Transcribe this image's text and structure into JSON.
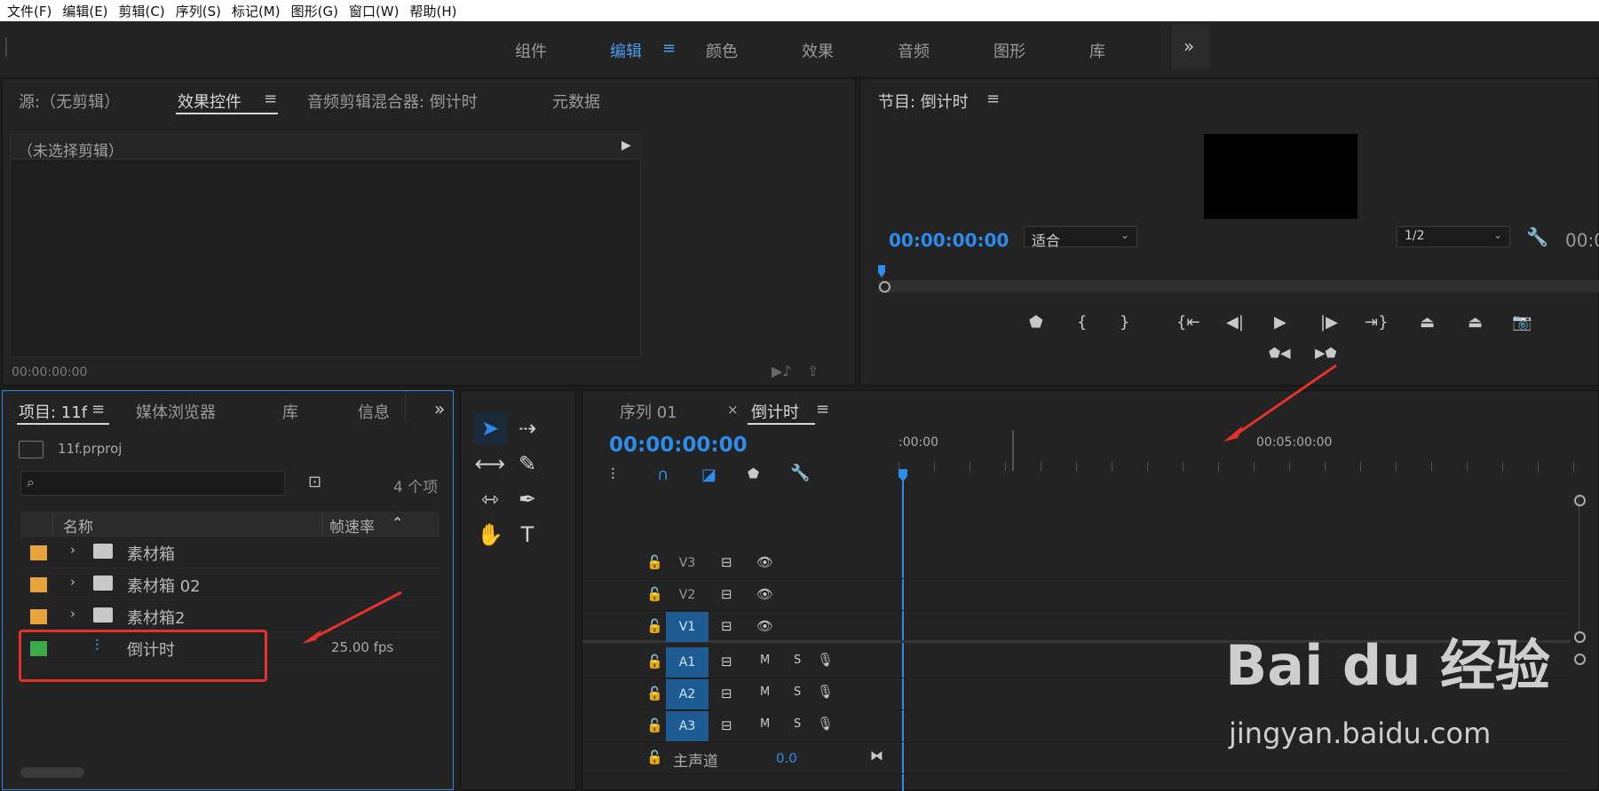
{
  "menu": [
    "文件(F)",
    "编辑(E)",
    "剪辑(C)",
    "序列(S)",
    "标记(M)",
    "图形(G)",
    "窗口(W)",
    "帮助(H)"
  ],
  "workspaces": {
    "items": [
      "组件",
      "编辑",
      "颜色",
      "效果",
      "音频",
      "图形",
      "库"
    ],
    "active": "编辑",
    "more": "»"
  },
  "source_panel": {
    "tabs": [
      "源:（无剪辑）",
      "效果控件",
      "音频剪辑混合器: 倒计时",
      "元数据"
    ],
    "active_tab": "效果控件",
    "no_clip": "（未选择剪辑）",
    "timecode": "00:00:00:00"
  },
  "program_panel": {
    "title": "节目: 倒计时",
    "timecode": "00:00:00:00",
    "fit": "适合",
    "resolution": "1/2",
    "timecode_right": "00:0"
  },
  "project_panel": {
    "tabs": [
      "项目: 11f",
      "媒体浏览器",
      "库",
      "信息"
    ],
    "active_tab": "项目: 11f",
    "file": "11f.prproj",
    "item_count": "4 个项",
    "search_placeholder": "",
    "columns": {
      "name": "名称",
      "fps": "帧速率"
    },
    "rows": [
      {
        "name": "素材箱",
        "fps": "",
        "color": "#e8a33a",
        "type": "bin"
      },
      {
        "name": "素材箱 02",
        "fps": "",
        "color": "#e8a33a",
        "type": "bin"
      },
      {
        "name": "素材箱2",
        "fps": "",
        "color": "#e8a33a",
        "type": "bin"
      },
      {
        "name": "倒计时",
        "fps": "25.00 fps",
        "color": "#3daa4a",
        "type": "sequence"
      }
    ]
  },
  "timeline": {
    "tabs": [
      "序列 01",
      "倒计时"
    ],
    "active_tab": "倒计时",
    "timecode": "00:00:00:00",
    "ruler": [
      ":00:00",
      "00:05:00:00"
    ],
    "video_tracks": [
      "V3",
      "V2",
      "V1"
    ],
    "audio_tracks": [
      "A1",
      "A2",
      "A3"
    ],
    "active_tracks": [
      "V1",
      "A1",
      "A2",
      "A3"
    ],
    "master": {
      "label": "主声道",
      "value": "0.0"
    },
    "m_label": "M",
    "s_label": "S"
  },
  "colors": {
    "accent": "#2d8ceb",
    "annotation": "#e5322d"
  },
  "watermark": {
    "brand": "Bai du 经验",
    "url": "jingyan.baidu.com"
  }
}
